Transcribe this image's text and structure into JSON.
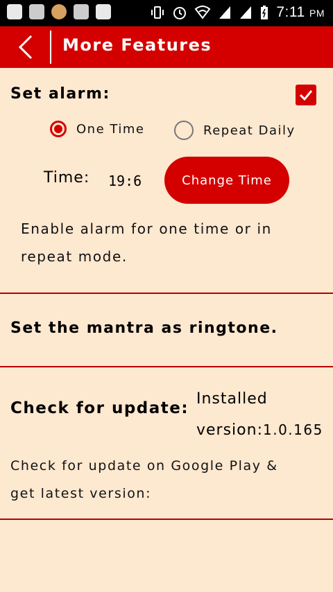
{
  "status_bar": {
    "time": "7:11",
    "ampm": "PM",
    "left_icons": [
      "message-icon",
      "gallery-icon",
      "avatar-icon",
      "alert-icon",
      "blank-icon"
    ],
    "right_icons": [
      "vibrate-icon",
      "alarm-icon",
      "wifi-icon",
      "signal-icon",
      "signal-icon",
      "battery-icon"
    ]
  },
  "app_bar": {
    "title": "More Features",
    "back_icon": "chevron-left-icon"
  },
  "alarm": {
    "heading": "Set alarm:",
    "enabled": true,
    "options": [
      {
        "label": "One Time",
        "selected": true
      },
      {
        "label": "Repeat Daily",
        "selected": false
      }
    ],
    "time_label": "Time:",
    "time_value": "19:6",
    "change_button": "Change Time",
    "description_line1": "Enable alarm for one time or in",
    "description_line2": "repeat mode."
  },
  "ringtone": {
    "label": "Set the mantra as ringtone."
  },
  "update": {
    "heading": "Check for update:",
    "installed_label_line1": "Installed",
    "installed_label_line2": "version:",
    "version": "1.0.165",
    "description_line1": "Check for update on Google Play &",
    "description_line2": "get latest version:"
  },
  "colors": {
    "accent": "#d40000",
    "background": "#fde8d0"
  }
}
